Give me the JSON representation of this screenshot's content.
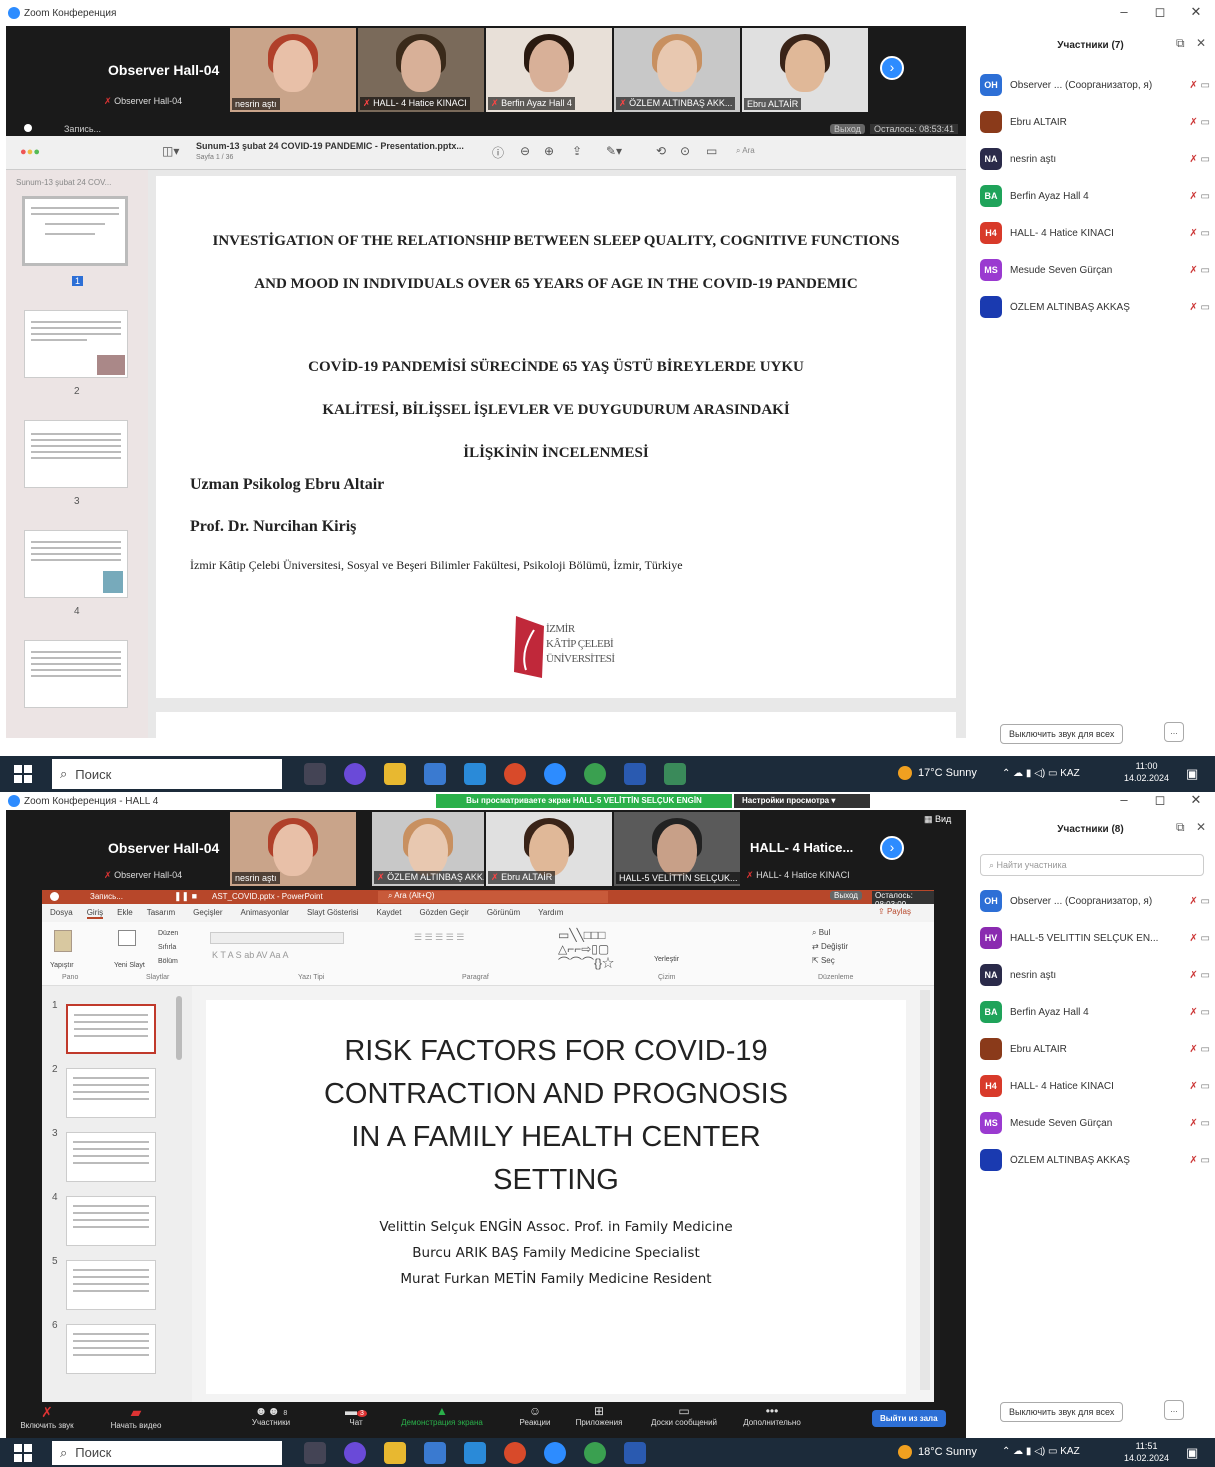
{
  "top": {
    "window_title": "Zoom Конференция",
    "observer_name": "Observer Hall-04",
    "observer_label": "Observer Hall-04",
    "tiles": [
      "nesrin aştı",
      "HALL- 4 Hatice KINACI",
      "Berfin Ayaz Hall 4",
      "ÖZLEM ALTINBAŞ AKK...",
      "Ebru ALTAİR"
    ],
    "rec_label": "Запись...",
    "exit_label": "Выход",
    "timer": "Осталось: 08:53:41",
    "doc_title": "Sunum-13 şubat 24 COVID-19 PANDEMIC - Presentation.pptx...",
    "page_info": "Sayfa 1 / 36",
    "search_placeholder": "Ara",
    "sidebar_file": "Sunum-13 şubat 24 COV...",
    "thumb_numbers": [
      "1",
      "2",
      "3",
      "4"
    ],
    "slide": {
      "title_en_1": "INVESTİGATION OF THE RELATIONSHIP BETWEEN SLEEP QUALITY, COGNITIVE FUNCTIONS",
      "title_en_2": "AND MOOD IN INDIVIDUALS OVER 65 YEARS OF AGE IN THE COVID-19 PANDEMIC",
      "title_tr_1": "COVİD-19 PANDEMİSİ SÜRECİNDE 65 YAŞ ÜSTÜ BİREYLERDE UYKU",
      "title_tr_2": "KALİTESİ, BİLİŞSEL İŞLEVLER VE DUYGUDURUM ARASINDAKİ",
      "title_tr_3": "İLİŞKİNİN İNCELENMESİ",
      "author_1": "Uzman Psikolog Ebru Altair",
      "author_2": "Prof. Dr. Nurcihan Kiriş",
      "affiliation": "İzmir Kâtip Çelebi Üniversitesi, Sosyal ve Beşeri Bilimler Fakültesi, Psikoloji Bölümü, İzmir, Türkiye",
      "logo_line_1": "İZMİR",
      "logo_line_2": "KÂTİP ÇELEBİ",
      "logo_line_3": "ÜNİVERSİTESİ"
    },
    "panel_title": "Участники (7)",
    "participants": [
      {
        "initials": "OH",
        "name": "Observer ... (Соорганизатор, я)",
        "color": "#2d6fd6"
      },
      {
        "initials": "",
        "name": "Ebru ALTAİR",
        "color": "#8a3a1a"
      },
      {
        "initials": "NA",
        "name": "nesrin aştı",
        "color": "#2a2a4a"
      },
      {
        "initials": "BA",
        "name": "Berfin Ayaz Hall 4",
        "color": "#1fa35a"
      },
      {
        "initials": "H4",
        "name": "HALL- 4 Hatice KINACI",
        "color": "#d83a2a"
      },
      {
        "initials": "MS",
        "name": "Mesude Seven Gürçan",
        "color": "#9a3ad0"
      },
      {
        "initials": "",
        "name": "ÖZLEM ALTINBAŞ AKKAŞ",
        "color": "#1a3ab0"
      }
    ],
    "mute_all": "Выключить звук для всех",
    "more": "...",
    "taskbar": {
      "search": "Поиск",
      "weather": "17°C Sunny",
      "lang": "KAZ",
      "time": "11:00",
      "date": "14.02.2024"
    }
  },
  "bottom": {
    "window_title": "Zoom Конференция - HALL 4",
    "banner": "Вы просматриваете экран HALL-5 VELİTTİN SELÇUK ENGİN",
    "view_options": "Настройки просмотра",
    "observer_name": "Observer Hall-04",
    "observer_label": "Observer Hall-04",
    "tiles": [
      "nesrin aştı",
      "ÖZLEM ALTINBAŞ AKK...",
      "Ebru ALTAİR",
      "HALL-5 VELİTTİN SELÇUK..."
    ],
    "hall_name": "HALL- 4 Hatice...",
    "hall_label": "HALL- 4 Hatice KINACI",
    "view_label": "Вид",
    "rec_label": "Запись...",
    "ppt_title": "AST_COVID.pptx - PowerPoint",
    "ppt_search": "Ara (Alt+Q)",
    "timer": "Осталось: 08:03:09",
    "exit_label": "Выход",
    "share_btn": "Paylaş",
    "ribbon_tabs": [
      "Dosya",
      "Giriş",
      "Ekle",
      "Tasarım",
      "Geçişler",
      "Animasyonlar",
      "Slayt Gösterisi",
      "Kaydet",
      "Gözden Geçir",
      "Görünüm",
      "Yardım"
    ],
    "ribbon_groups": [
      "Pano",
      "Slaytlar",
      "Yazı Tipi",
      "Paragraf",
      "Çizim",
      "Düzenleme"
    ],
    "ribbon_items": {
      "paste": "Yapıştır",
      "new_slide": "Yeni Slayt",
      "layout": "Düzen",
      "reset": "Sıfırla",
      "section": "Bölüm",
      "arrange": "Yerleştir",
      "find": "Bul",
      "replace": "Değiştir",
      "select": "Seç"
    },
    "thumb_numbers": [
      "1",
      "2",
      "3",
      "4",
      "5",
      "6"
    ],
    "slide": {
      "title_1": "RISK FACTORS FOR COVID-19",
      "title_2": "CONTRACTION AND PROGNOSIS",
      "title_3": "IN A FAMILY HEALTH CENTER",
      "title_4": "SETTING",
      "author_1": "Velittin Selçuk ENGİN Assoc. Prof. in Family Medicine",
      "author_2": "Burcu ARIK BAŞ Family Medicine Specialist",
      "author_3": "Murat Furkan METİN Family Medicine Resident"
    },
    "panel_title": "Участники (8)",
    "search_placeholder": "Найти участника",
    "participants": [
      {
        "initials": "OH",
        "name": "Observer ... (Соорганизатор, я)",
        "color": "#2d6fd6"
      },
      {
        "initials": "HV",
        "name": "HALL-5 VELİTTİN SELÇUK EN...",
        "color": "#8a2ab0"
      },
      {
        "initials": "NA",
        "name": "nesrin aştı",
        "color": "#2a2a4a"
      },
      {
        "initials": "BA",
        "name": "Berfin Ayaz Hall 4",
        "color": "#1fa35a"
      },
      {
        "initials": "",
        "name": "Ebru ALTAİR",
        "color": "#8a3a1a"
      },
      {
        "initials": "H4",
        "name": "HALL- 4 Hatice KINACI",
        "color": "#d83a2a"
      },
      {
        "initials": "MS",
        "name": "Mesude Seven Gürçan",
        "color": "#9a3ad0"
      },
      {
        "initials": "",
        "name": "ÖZLEM ALTINBAŞ AKKAŞ",
        "color": "#1a3ab0"
      }
    ],
    "mute_all": "Выключить звук для всех",
    "more": "...",
    "toolbar": {
      "unmute": "Включить звук",
      "start_video": "Начать видео",
      "participants": "Участники",
      "participants_count": "8",
      "chat": "Чат",
      "chat_badge": "3",
      "share": "Демонстрация экрана",
      "reactions": "Реакции",
      "apps": "Приложения",
      "whiteboards": "Доски сообщений",
      "more": "Дополнительно",
      "leave": "Выйти из зала"
    },
    "taskbar": {
      "search": "Поиск",
      "weather": "18°C Sunny",
      "lang": "KAZ",
      "time": "11:51",
      "date": "14.02.2024"
    }
  }
}
